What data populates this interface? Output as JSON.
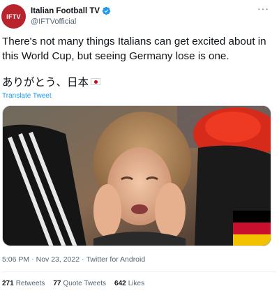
{
  "author": {
    "avatar_text": "IFTV",
    "display_name": "Italian Football TV",
    "handle": "@IFTVofficial"
  },
  "tweet": {
    "text": "There's not many things Italians can get excited about in this World Cup, but seeing Germany lose is one.",
    "japanese_text": "ありがとう、日本",
    "translate_label": "Translate Tweet"
  },
  "meta": {
    "time": "5:06 PM",
    "date": "Nov 23, 2022",
    "source": "Twitter for Android",
    "separator": "·"
  },
  "stats": {
    "retweets_count": "271",
    "retweets_label": "Retweets",
    "quotes_count": "77",
    "quotes_label": "Quote Tweets",
    "likes_count": "642",
    "likes_label": "Likes"
  },
  "colors": {
    "accent": "#1d9bf0",
    "avatar_bg": "#b8232e",
    "muted": "#536471"
  },
  "icons": {
    "verified": "verified-badge-icon",
    "more": "more-options-icon",
    "flag": "japan-flag-icon"
  }
}
